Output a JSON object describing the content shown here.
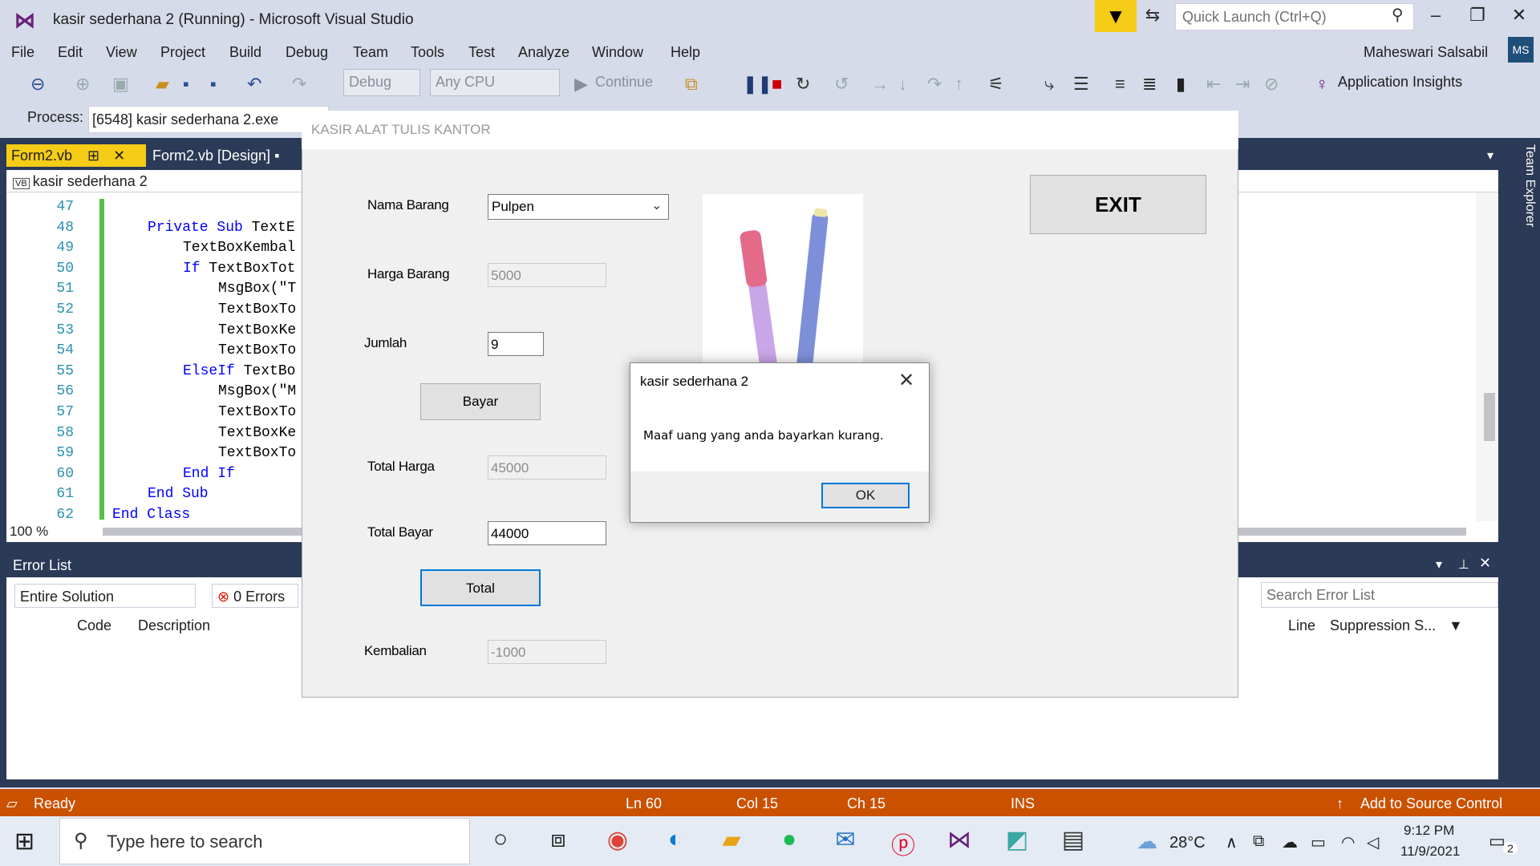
{
  "window": {
    "title": "kasir sederhana 2 (Running) - Microsoft Visual Studio",
    "quick_launch_placeholder": "Quick Launch (Ctrl+Q)"
  },
  "menu": [
    "File",
    "Edit",
    "View",
    "Project",
    "Build",
    "Debug",
    "Team",
    "Tools",
    "Test",
    "Analyze",
    "Window",
    "Help"
  ],
  "user": {
    "name": "Maheswari Salsabil",
    "initials": "MS"
  },
  "toolbar": {
    "config": "Debug",
    "platform": "Any CPU",
    "continue": "Continue",
    "app_insights": "Application Insights"
  },
  "process": {
    "label": "Process:",
    "value": "[6548] kasir sederhana 2.exe"
  },
  "tabs": {
    "active": "Form2.vb",
    "design": "Form2.vb [Design]"
  },
  "editor": {
    "nav_project": "kasir sederhana 2",
    "zoom": "100 %",
    "lines": [
      {
        "n": "47",
        "code": ""
      },
      {
        "n": "48",
        "kw": "Private Sub",
        "code": " TextE"
      },
      {
        "n": "49",
        "code": "TextBoxKembal"
      },
      {
        "n": "50",
        "kw": "If",
        "code": " TextBoxTot"
      },
      {
        "n": "51",
        "code": "MsgBox(\"T"
      },
      {
        "n": "52",
        "code": "TextBoxTo"
      },
      {
        "n": "53",
        "code": "TextBoxKe"
      },
      {
        "n": "54",
        "code": "TextBoxTo"
      },
      {
        "n": "55",
        "kw": "ElseIf",
        "code": " TextBo"
      },
      {
        "n": "56",
        "code": "MsgBox(\"M"
      },
      {
        "n": "57",
        "code": "TextBoxTo"
      },
      {
        "n": "58",
        "code": "TextBoxKe"
      },
      {
        "n": "59",
        "code": "TextBoxTo"
      },
      {
        "n": "60",
        "kw": "End If",
        "code": ""
      },
      {
        "n": "61",
        "kw": "End Sub",
        "code": ""
      },
      {
        "n": "62",
        "kw": "End Class",
        "code": ""
      }
    ]
  },
  "error_list": {
    "title": "Error List",
    "scope": "Entire Solution",
    "errors": "0 Errors",
    "search_placeholder": "Search Error List",
    "columns": {
      "code": "Code",
      "description": "Description",
      "line": "Line",
      "suppression": "Suppression S..."
    }
  },
  "team_explorer": "Team Explorer",
  "status": {
    "ready": "Ready",
    "ln": "Ln 60",
    "col": "Col 15",
    "ch": "Ch 15",
    "ins": "INS",
    "source_control": "Add to Source Control"
  },
  "form": {
    "title": "KASIR ALAT TULIS KANTOR",
    "nama_barang_label": "Nama Barang",
    "nama_barang_value": "Pulpen",
    "harga_label": "Harga Barang",
    "harga_value": "5000",
    "jumlah_label": "Jumlah",
    "jumlah_value": "9",
    "bayar_button": "Bayar",
    "total_harga_label": "Total Harga",
    "total_harga_value": "45000",
    "total_bayar_label": "Total Bayar",
    "total_bayar_value": "44000",
    "total_button": "Total",
    "kembalian_label": "Kembalian",
    "kembalian_value": "-1000",
    "exit_button": "EXIT"
  },
  "msgbox": {
    "title": "kasir sederhana 2",
    "message": "Maaf uang yang anda bayarkan kurang.",
    "ok": "OK"
  },
  "taskbar": {
    "search_placeholder": "Type here to search",
    "temperature": "28°C",
    "time": "9:12 PM",
    "date": "11/9/2021",
    "notification_count": "2"
  },
  "colors": {
    "accent_orange": "#ca5100",
    "vs_purple": "#68217a",
    "focus_blue": "#0078d7",
    "dark_band": "#2b3a56"
  }
}
